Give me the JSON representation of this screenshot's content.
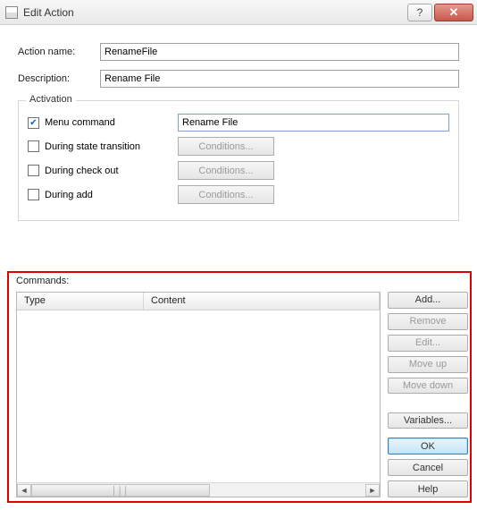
{
  "window": {
    "title": "Edit Action"
  },
  "form": {
    "action_name_label": "Action name:",
    "action_name_value": "RenameFile",
    "description_label": "Description:",
    "description_value": "Rename File"
  },
  "activation": {
    "legend": "Activation",
    "menu_command_label": "Menu command",
    "menu_command_checked": true,
    "menu_command_value": "Rename File",
    "during_state_label": "During state transition",
    "during_checkout_label": "During check out",
    "during_add_label": "During add",
    "conditions_label": "Conditions..."
  },
  "commands": {
    "label": "Commands:",
    "columns": {
      "type": "Type",
      "content": "Content"
    }
  },
  "buttons": {
    "add": "Add...",
    "remove": "Remove",
    "edit": "Edit...",
    "moveup": "Move up",
    "movedown": "Move down",
    "variables": "Variables...",
    "ok": "OK",
    "cancel": "Cancel",
    "help": "Help"
  }
}
